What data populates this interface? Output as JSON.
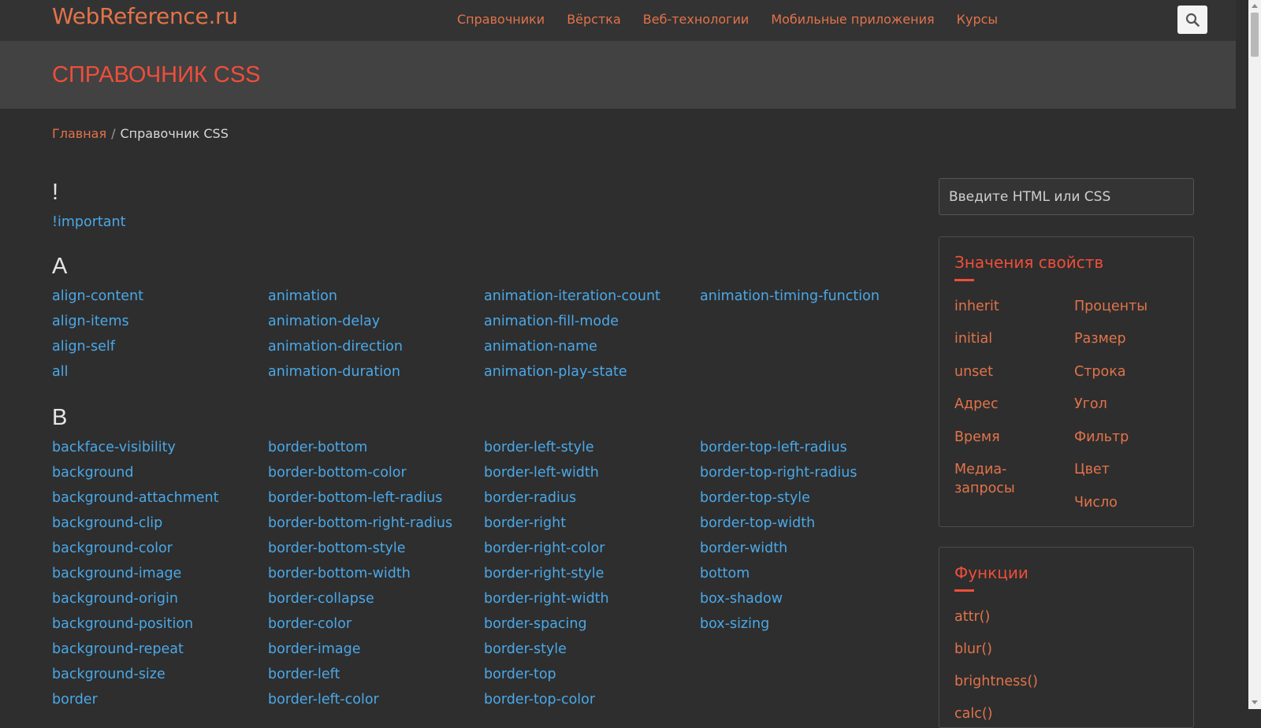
{
  "header": {
    "logo": "WebReference.ru",
    "nav": [
      "Справочники",
      "Вёрстка",
      "Веб-технологии",
      "Мобильные приложения",
      "Курсы"
    ]
  },
  "page_title": "СПРАВОЧНИК CSS",
  "breadcrumb": {
    "home": "Главная",
    "separator": "/",
    "current": "Справочник CSS"
  },
  "index": [
    {
      "letter": "!",
      "items": [
        "!important"
      ]
    },
    {
      "letter": "A",
      "items": [
        "align-content",
        "align-items",
        "align-self",
        "all",
        "animation",
        "animation-delay",
        "animation-direction",
        "animation-duration",
        "animation-iteration-count",
        "animation-fill-mode",
        "animation-name",
        "animation-play-state",
        "animation-timing-function"
      ]
    },
    {
      "letter": "B",
      "items": [
        "backface-visibility",
        "background",
        "background-attachment",
        "background-clip",
        "background-color",
        "background-image",
        "background-origin",
        "background-position",
        "background-repeat",
        "background-size",
        "border",
        "border-bottom",
        "border-bottom-color",
        "border-bottom-left-radius",
        "border-bottom-right-radius",
        "border-bottom-style",
        "border-bottom-width",
        "border-collapse",
        "border-color",
        "border-image",
        "border-left",
        "border-left-color",
        "border-left-style",
        "border-left-width",
        "border-radius",
        "border-right",
        "border-right-color",
        "border-right-style",
        "border-right-width",
        "border-spacing",
        "border-style",
        "border-top",
        "border-top-color",
        "border-top-left-radius",
        "border-top-right-radius",
        "border-top-style",
        "border-top-width",
        "border-width",
        "bottom",
        "box-shadow",
        "box-sizing"
      ]
    }
  ],
  "sidebar": {
    "search_placeholder": "Введите HTML или CSS",
    "values_card": {
      "title": "Значения свойств",
      "links": [
        "inherit",
        "initial",
        "unset",
        "Адрес",
        "Время",
        "Медиа-\nзапросы",
        "Проценты",
        "Размер",
        "Строка",
        "Угол",
        "Фильтр",
        "Цвет",
        "Число"
      ]
    },
    "functions_card": {
      "title": "Функции",
      "links": [
        "attr()",
        "blur()",
        "brightness()",
        "calc()"
      ]
    }
  },
  "colors": {
    "background": "#2e2e2e",
    "header": "#333333",
    "title_band": "#424242",
    "link_blue": "#4aa8e8",
    "link_orange": "#e2734a",
    "accent_red": "#ef4e3a"
  },
  "icons": {
    "search": "search-icon"
  }
}
